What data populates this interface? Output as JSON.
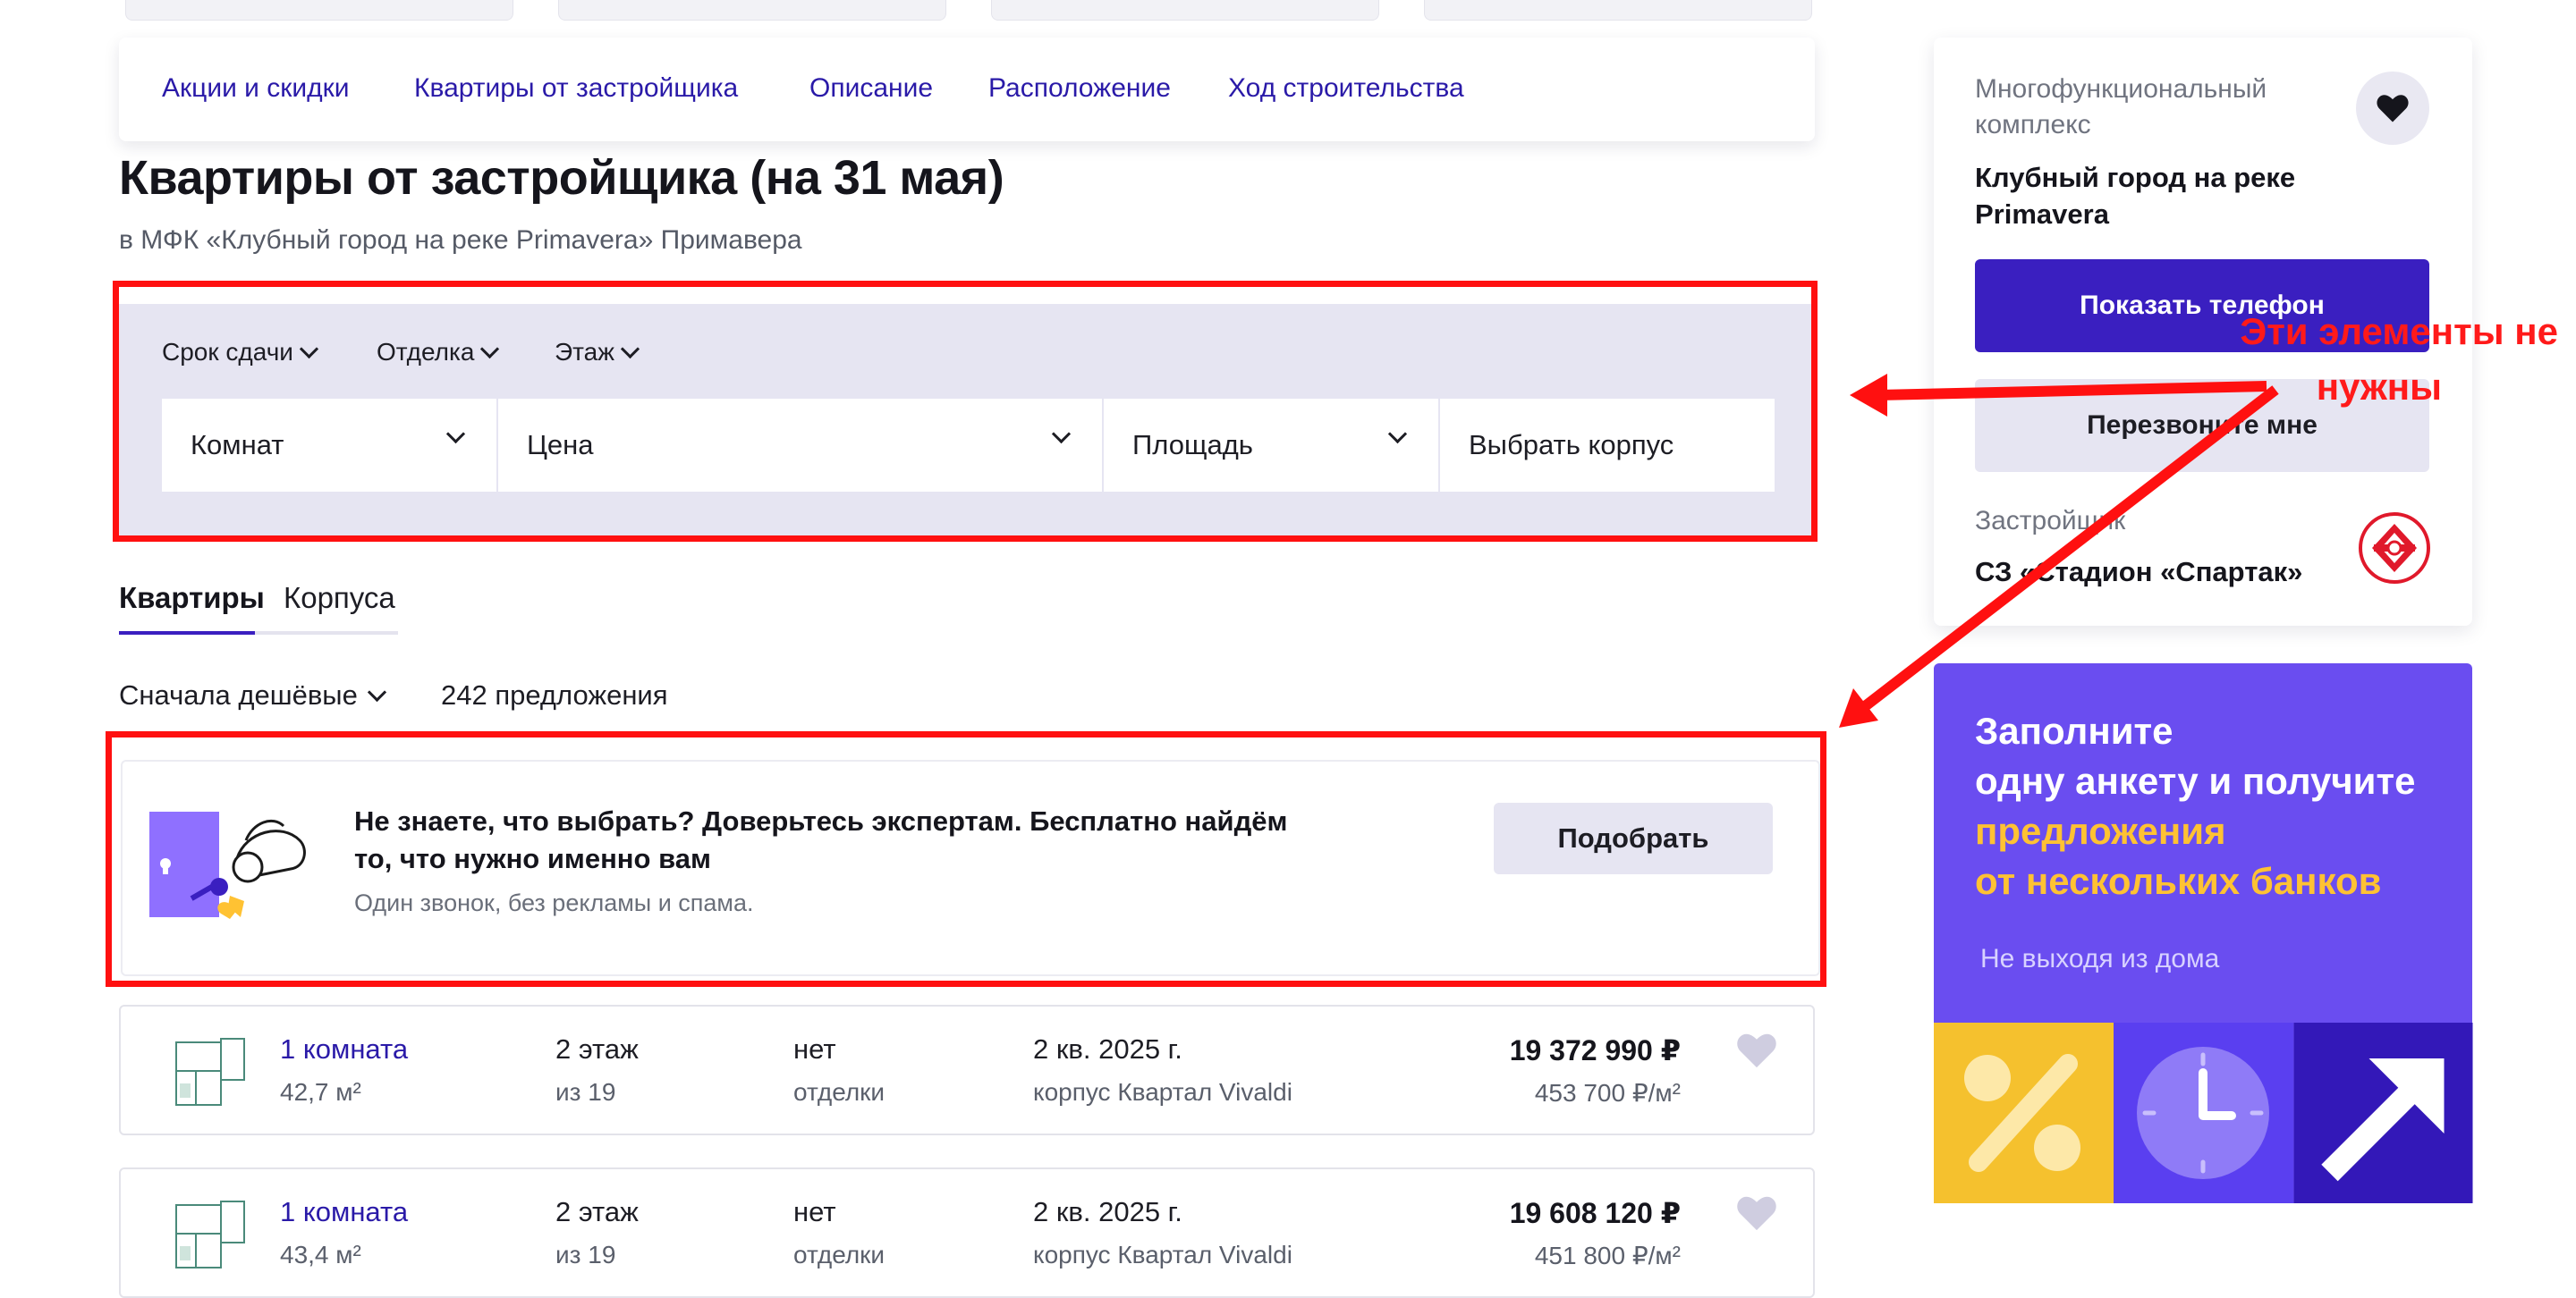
{
  "nav": {
    "items": [
      "Акции и скидки",
      "Квартиры от застройщика",
      "Описание",
      "Расположение",
      "Ход строительства"
    ]
  },
  "page": {
    "title": "Квартиры от застройщика (на 31 мая)",
    "subtitle": "в МФК «Клубный город на реке Primavera» Примавера"
  },
  "filters": {
    "chips": [
      "Срок сдачи",
      "Отделка",
      "Этаж"
    ],
    "fields": [
      "Комнат",
      "Цена",
      "Площадь",
      "Выбрать корпус"
    ]
  },
  "annotation": {
    "line1": "Эти элементы не",
    "line2": "нужны",
    "color": "#ff1010"
  },
  "tabs": [
    "Квартиры",
    "Корпуса"
  ],
  "active_tab": "Квартиры",
  "sort": {
    "label": "Сначала дешёвые",
    "count": "242 предложения"
  },
  "expert": {
    "title": "Не знаете, что выбрать? Доверьтесь экспертам. Бесплатно найдём то, что нужно именно вам",
    "subtitle": "Один звонок, без рекламы и спама.",
    "button": "Подобрать"
  },
  "listings": [
    {
      "rooms": "1 комната",
      "area": "42,7 м²",
      "floor": "2 этаж",
      "floor_of": "из 19",
      "finish1": "нет",
      "finish2": "отделки",
      "due": "2 кв. 2025 г.",
      "building": "корпус Квартал Vivaldi",
      "price": "19 372 990 ₽",
      "price_per_m2": "453 700 ₽/м²"
    },
    {
      "rooms": "1 комната",
      "area": "43,4 м²",
      "floor": "2 этаж",
      "floor_of": "из 19",
      "finish1": "нет",
      "finish2": "отделки",
      "due": "2 кв. 2025 г.",
      "building": "корпус Квартал Vivaldi",
      "price": "19 608 120 ₽",
      "price_per_m2": "451 800 ₽/м²"
    }
  ],
  "sidebar": {
    "type": "Многофункциональный комплекс",
    "name": "Клубный город на реке Primavera",
    "show_phone": "Показать телефон",
    "callback": "Перезвоните мне",
    "developer_label": "Застройщик",
    "developer_name": "СЗ «Стадион «Спартак»"
  },
  "promo": {
    "line1": "Заполните",
    "line2": "одну анкету и получите",
    "line3": "предложения",
    "line4": "от нескольких банков",
    "subtitle": "Не выходя из дома"
  },
  "colors": {
    "accent": "#3a1fc0",
    "link": "#2a1aa8",
    "panel": "#e6e5f2",
    "promo_bg": "#6a4df0",
    "promo_highlight": "#ffc233"
  },
  "icons": [
    "chevron-down-icon",
    "heart-icon",
    "spartak-logo",
    "percent-icon",
    "clock-icon",
    "arrow-up-right-icon",
    "key-hand-illustration",
    "floorplan-thumbnail"
  ]
}
